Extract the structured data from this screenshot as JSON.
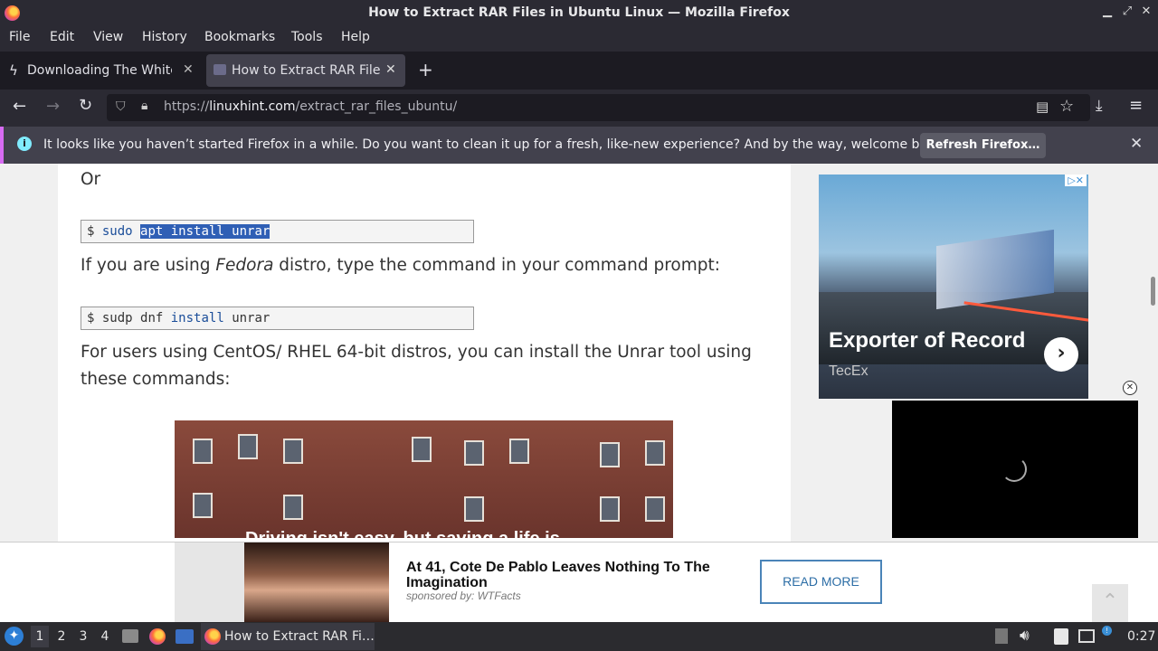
{
  "window": {
    "title": "How to Extract RAR Files in Ubuntu Linux — Mozilla Firefox"
  },
  "menu": [
    "File",
    "Edit",
    "View",
    "History",
    "Bookmarks",
    "Tools",
    "Help"
  ],
  "tabs": [
    {
      "label": "Downloading The White H",
      "active": false
    },
    {
      "label": "How to Extract RAR Files",
      "active": true
    }
  ],
  "urlbar": {
    "prefix": "https://",
    "domain": "linuxhint.com",
    "path": "/extract_rar_files_ubuntu/"
  },
  "notification": {
    "message": "It looks like you haven’t started Firefox in a while. Do you want to clean it up for a fresh, like-new experience? And by the way, welcome back!",
    "button": "Refresh Firefox…"
  },
  "article": {
    "or": "Or",
    "cmd1": {
      "prompt": "$",
      "parts": [
        "sudo",
        "apt install unrar"
      ]
    },
    "para1_pre": "If you are using ",
    "para1_em": "Fedora",
    "para1_post": " distro, type the command in your command prompt:",
    "cmd2": {
      "prompt": "$",
      "parts": [
        "sudp dnf",
        "install",
        "unrar"
      ]
    },
    "para2": "For users using CentOS/ RHEL 64-bit distros, you can install the Unrar tool using these commands:",
    "ad_caption": "Driving isn't easy, but saving a life is"
  },
  "sidebar_ad": {
    "headline": "Exporter of Record",
    "brand": "TecEx",
    "adchoice": "▷✕"
  },
  "bottom_ad": {
    "headline": "At 41, Cote De Pablo Leaves Nothing To The Imagination",
    "sponsor": "sponsored by: WTFacts",
    "button": "READ MORE"
  },
  "taskbar": {
    "workspaces": [
      "1",
      "2",
      "3",
      "4"
    ],
    "current_workspace": "1",
    "app_label": "How to Extract RAR Fi…",
    "clock": "0:27"
  }
}
